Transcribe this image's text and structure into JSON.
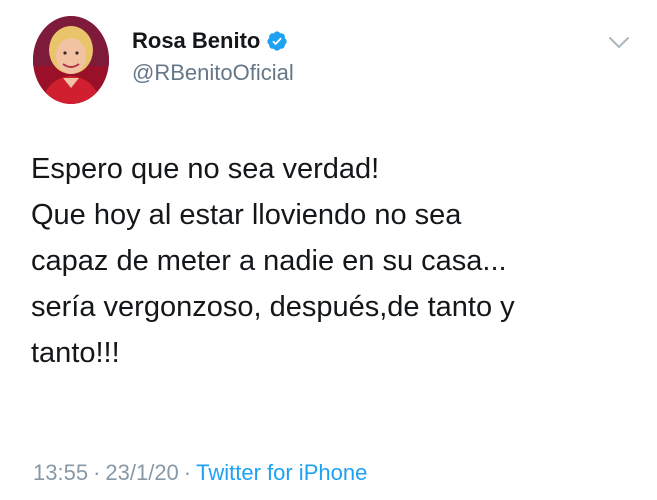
{
  "author": {
    "display_name": "Rosa Benito",
    "handle": "@RBenitoOficial",
    "verified": true,
    "verified_icon": "verified-badge-icon",
    "avatar_icon": "avatar"
  },
  "tweet": {
    "lines": [
      "Espero que no sea verdad!",
      "Que hoy al estar lloviendo no sea",
      "capaz de meter a nadie en su casa...",
      "sería vergonzoso, después,de tanto y",
      "tanto!!!"
    ]
  },
  "meta": {
    "time": "13:55",
    "separator": "·",
    "date": "23/1/20",
    "source": "Twitter for iPhone"
  },
  "menu": {
    "icon": "chevron-down-icon"
  },
  "colors": {
    "text": "#14171a",
    "secondary": "#657786",
    "meta": "#8899a6",
    "link": "#1da1f2",
    "verified": "#1da1f2",
    "avatar_bg": "#a8142a"
  }
}
